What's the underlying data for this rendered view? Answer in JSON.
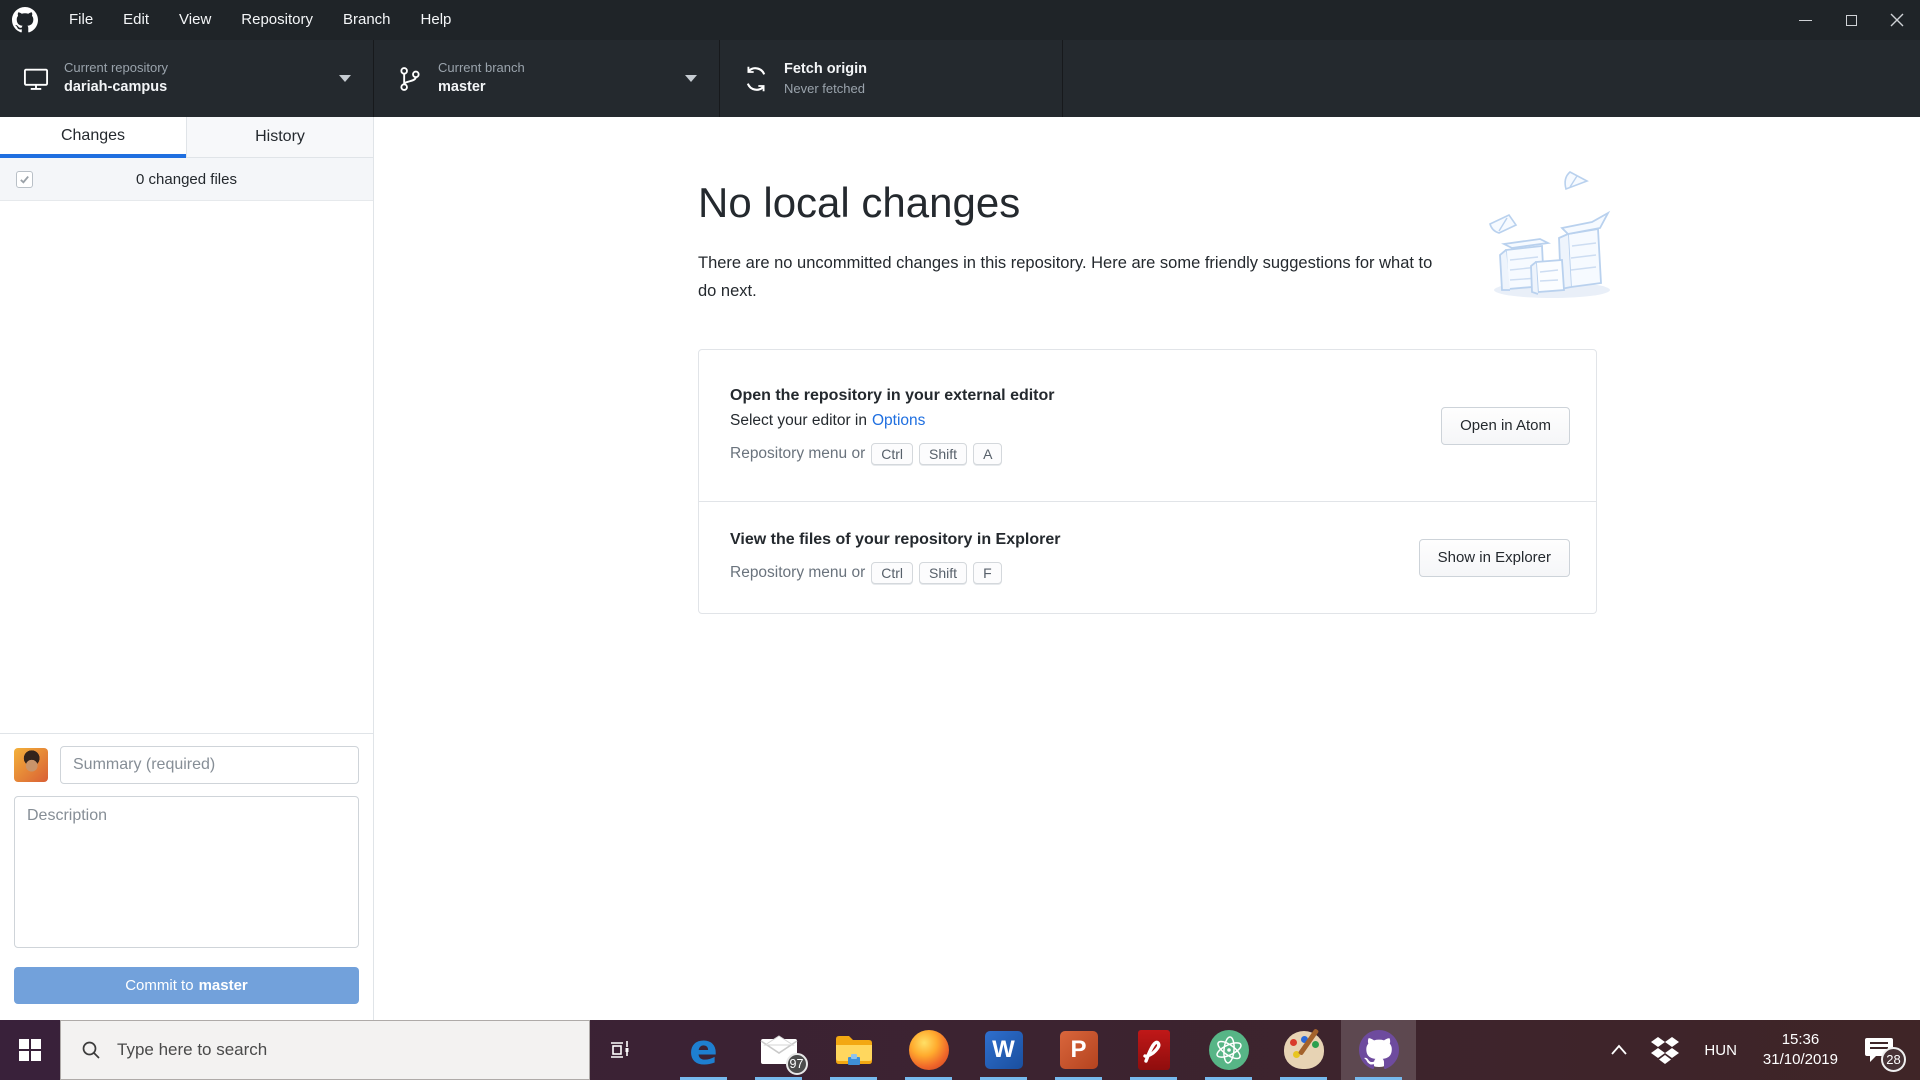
{
  "window": {
    "menu": [
      "File",
      "Edit",
      "View",
      "Repository",
      "Branch",
      "Help"
    ]
  },
  "toolbar": {
    "repository": {
      "label": "Current repository",
      "value": "dariah-campus"
    },
    "branch": {
      "label": "Current branch",
      "value": "master"
    },
    "fetch": {
      "label": "Fetch origin",
      "status": "Never fetched"
    }
  },
  "sidebar": {
    "tabs": [
      {
        "label": "Changes",
        "active": true
      },
      {
        "label": "History",
        "active": false
      }
    ],
    "changed_files": "0 changed files",
    "changes_checkbox_checked": true,
    "summary_placeholder": "Summary (required)",
    "description_placeholder": "Description",
    "commit": {
      "prefix": "Commit to",
      "branch": "master"
    }
  },
  "main": {
    "title": "No local changes",
    "subtitle": "There are no uncommitted changes in this repository. Here are some friendly suggestions for what to do next.",
    "cards": [
      {
        "title": "Open the repository in your external editor",
        "line2_prefix": "Select your editor in",
        "line2_link": "Options",
        "shortcut_prefix": "Repository menu or",
        "keys": [
          "Ctrl",
          "Shift",
          "A"
        ],
        "button": "Open in Atom"
      },
      {
        "title": "View the files of your repository in Explorer",
        "shortcut_prefix": "Repository menu or",
        "keys": [
          "Ctrl",
          "Shift",
          "F"
        ],
        "button": "Show in Explorer"
      }
    ]
  },
  "taskbar": {
    "search": {
      "placeholder": "Type here to search"
    },
    "apps": [
      {
        "name": "edge",
        "glyph": "e"
      },
      {
        "name": "mail",
        "badge": "97"
      },
      {
        "name": "file-explorer"
      },
      {
        "name": "firefox"
      },
      {
        "name": "word",
        "glyph": "W"
      },
      {
        "name": "powerpoint",
        "glyph": "P"
      },
      {
        "name": "acrobat"
      },
      {
        "name": "atom"
      },
      {
        "name": "paint"
      },
      {
        "name": "github-desktop",
        "active": true
      }
    ],
    "tray": {
      "language": "HUN",
      "time": "15:36",
      "date": "31/10/2019",
      "notification_badge": "28"
    }
  },
  "colors": {
    "header_bg": "#24292e",
    "menubar_bg": "#1f2428",
    "accent_blue": "#1f6fe0",
    "commit_button_blue": "#72a1db",
    "taskbar_left": "#39213a",
    "taskbar_right": "#3f2527",
    "underline_blue": "#76b9ed",
    "illustration_blue": "#b9d1ee"
  }
}
